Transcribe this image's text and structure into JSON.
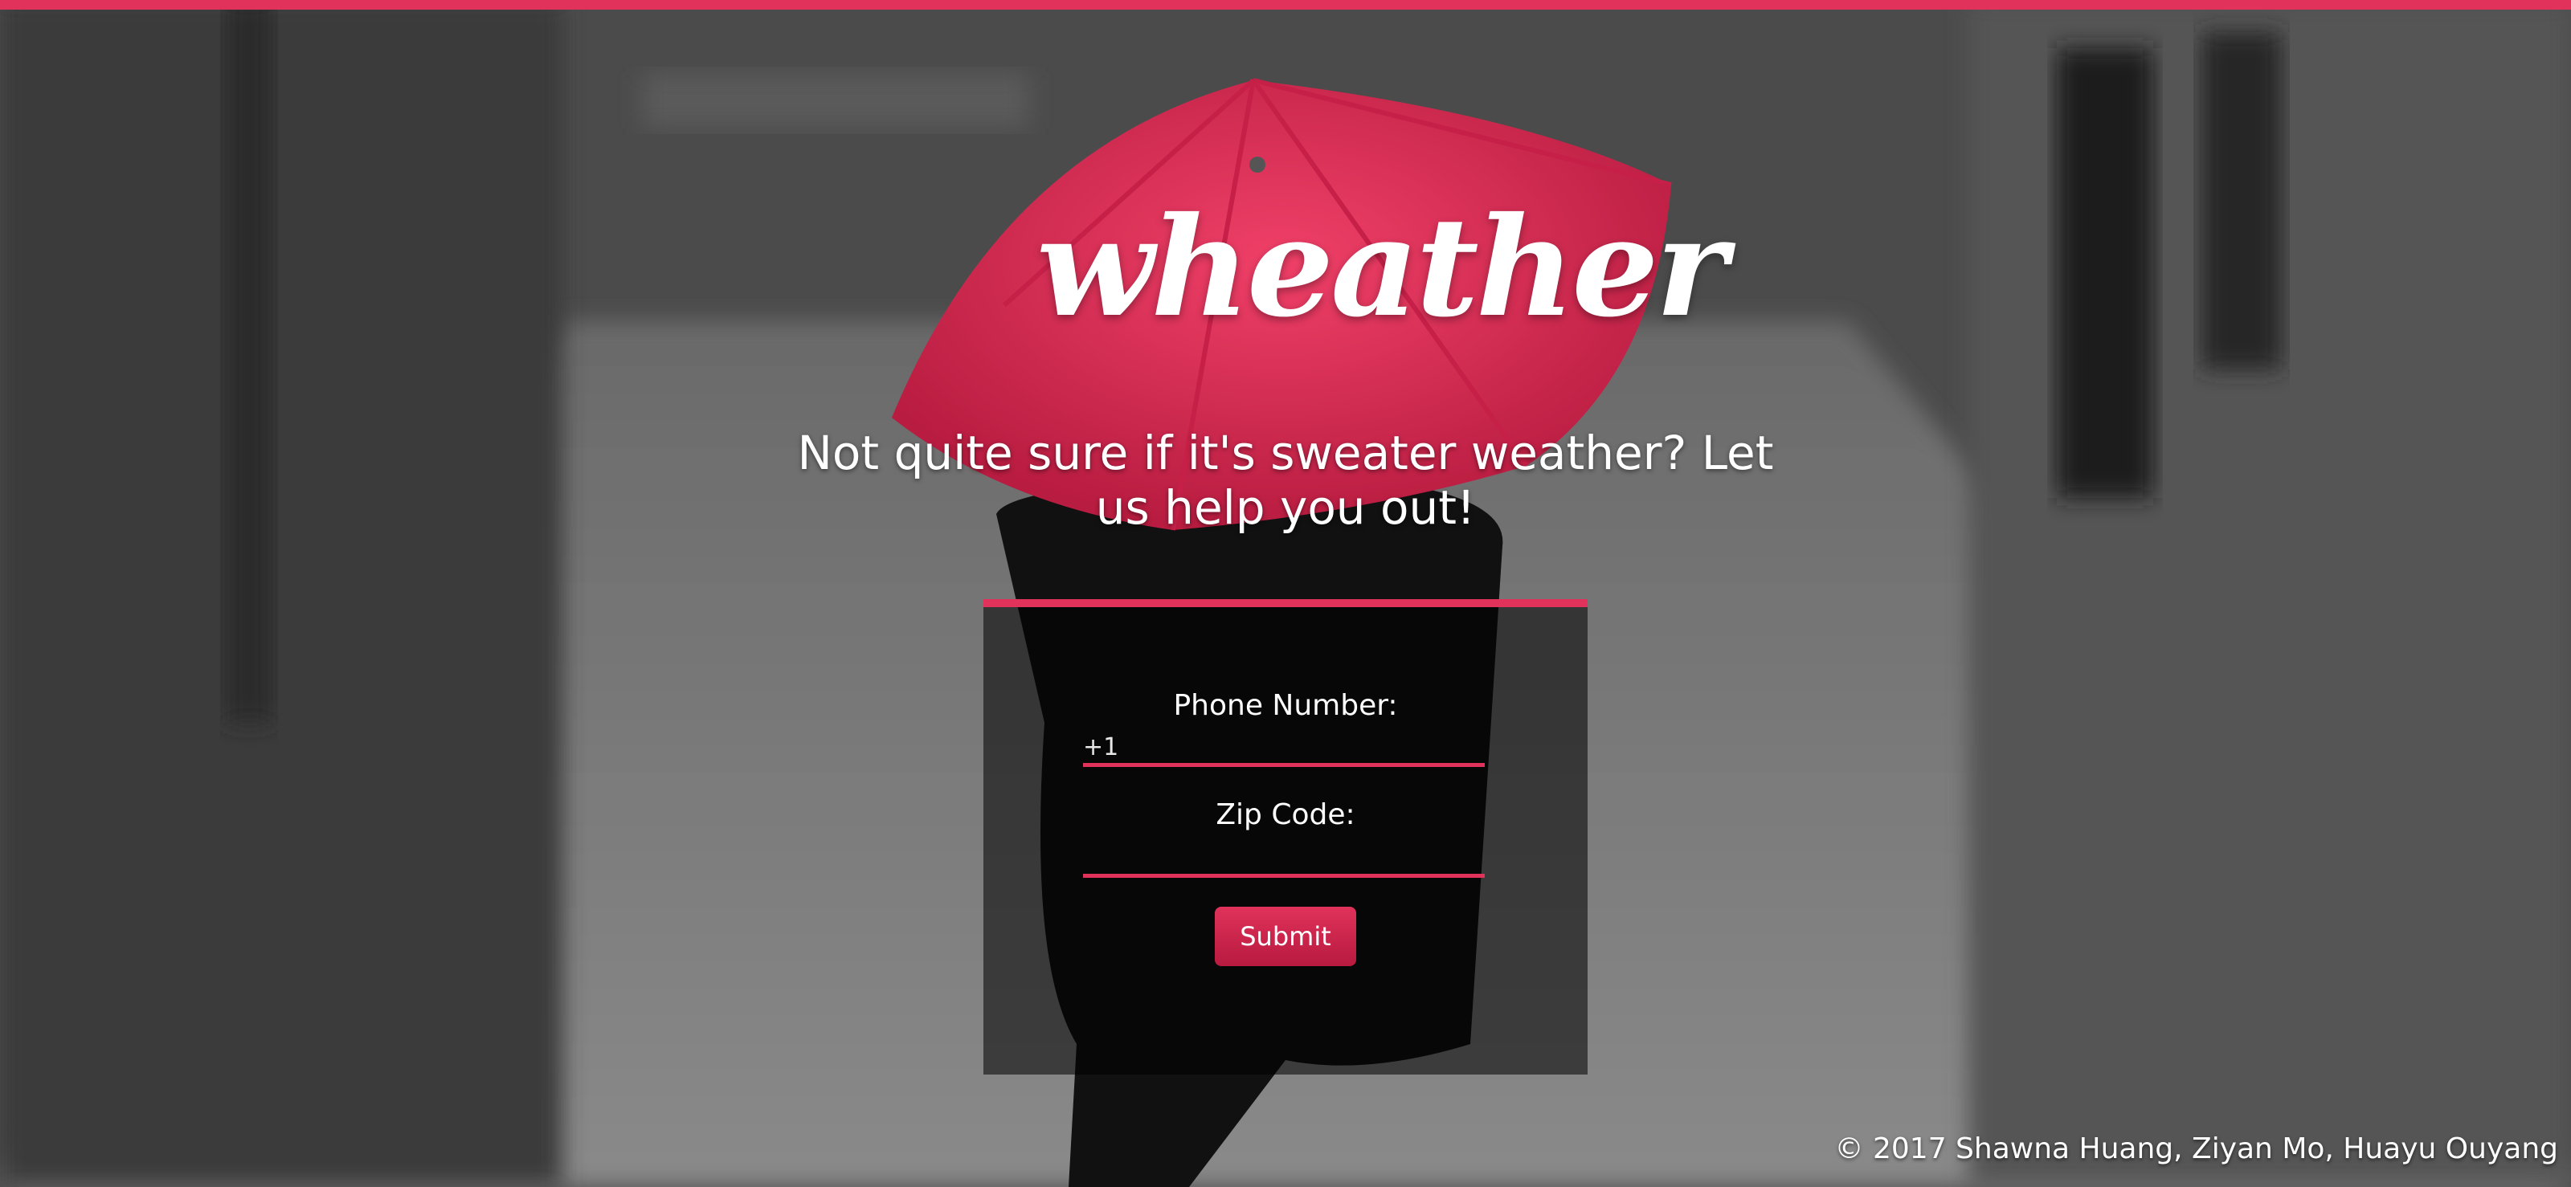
{
  "brand": {
    "logo_text": "wheather",
    "accent_color": "#e0325a"
  },
  "hero": {
    "tagline": "Not quite sure if it's sweater weather? Let us help you out!"
  },
  "form": {
    "phone_label": "Phone Number:",
    "phone_placeholder": "+1",
    "zip_label": "Zip Code:",
    "zip_placeholder": "",
    "submit_label": "Submit"
  },
  "footer": {
    "copyright": "© 2017 Shawna Huang, Ziyan Mo, Huayu Ouyang"
  },
  "background": {
    "subject": "person-with-red-umbrella-photo",
    "umbrella_color": "#e0325a"
  }
}
